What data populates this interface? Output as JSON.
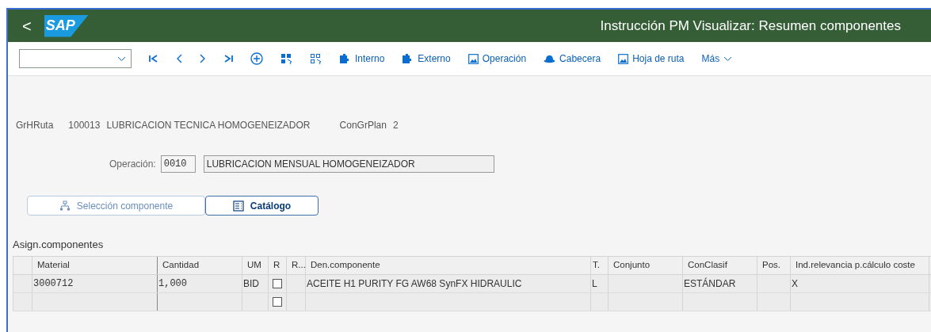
{
  "header": {
    "back": "<",
    "logo": "SAP",
    "title": "Instrucción PM Visualizar: Resumen componentes"
  },
  "toolbar": {
    "items": [
      {
        "kind": "first"
      },
      {
        "kind": "prev"
      },
      {
        "kind": "next"
      },
      {
        "kind": "last"
      },
      {
        "kind": "add"
      },
      {
        "kind": "select-all"
      },
      {
        "kind": "deselect-all"
      },
      {
        "kind": "puzzle",
        "label": "Interno"
      },
      {
        "kind": "puzzle",
        "label": "Externo"
      },
      {
        "kind": "image",
        "label": "Operación"
      },
      {
        "kind": "hat",
        "label": "Cabecera"
      },
      {
        "kind": "image",
        "label": "Hoja de ruta"
      },
      {
        "kind": "menu",
        "label": "Más"
      }
    ]
  },
  "route": {
    "label": "GrHRuta",
    "number": "100013",
    "name": "LUBRICACION TECNICA HOMOGENEIZADOR",
    "plan_label": "ConGrPlan",
    "plan_value": "2"
  },
  "operation": {
    "label": "Operación:",
    "number": "0010",
    "description": "LUBRICACION MENSUAL HOMOGENEIZADOR"
  },
  "tabs": [
    {
      "label": "Selección componente",
      "selected": false,
      "kind": "tree"
    },
    {
      "label": "Catálogo",
      "selected": true,
      "kind": "list"
    }
  ],
  "table": {
    "title": "Asign.componentes",
    "columns": [
      "Material",
      "Cantidad",
      "UM",
      "R",
      "R...",
      "Den.componente",
      "T.",
      "Conjunto",
      "ConClasif",
      "Pos.",
      "Ind.relevancia p.cálculo coste"
    ],
    "rows": [
      {
        "cells": [
          "3000712",
          "1,000",
          "BID",
          "",
          "",
          "ACEITE H1 PURITY FG AW68 SynFX HIDRAULIC",
          "L",
          "",
          "ESTÁNDAR",
          "",
          "X"
        ],
        "checked": false
      },
      {
        "cells": [
          "",
          "",
          "",
          "",
          "",
          "",
          "",
          "",
          "",
          "",
          ""
        ],
        "checked": false
      }
    ]
  }
}
